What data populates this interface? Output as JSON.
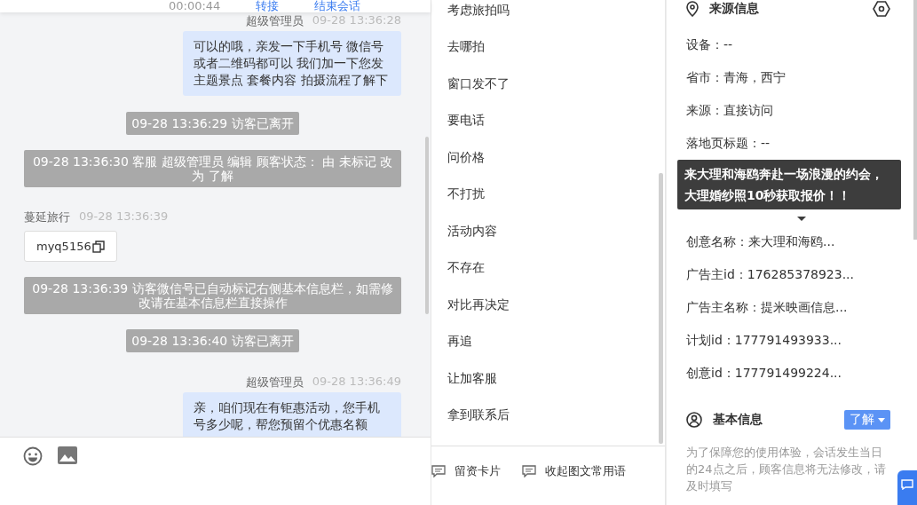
{
  "header": {
    "timer": "00:00:44",
    "actions": [
      "转接",
      "结束会话"
    ]
  },
  "messages": [
    {
      "kind": "meta",
      "outgoing": true,
      "name": "超级管理员",
      "time": "09-28 13:36:28"
    },
    {
      "kind": "bubble",
      "outgoing": true,
      "text": "可以的哦，亲发一下手机号 微信号或者二维码都可以 我们加一下您发主题景点 套餐内容 拍摄流程了解下"
    },
    {
      "kind": "system",
      "text": "09-28 13:36:29 访客已离开"
    },
    {
      "kind": "system",
      "text": "09-28 13:36:30 客服 超级管理员 编辑 顾客状态： 由 未标记 改为 了解"
    },
    {
      "kind": "meta",
      "outgoing": false,
      "name": "蔓延旅行",
      "time": "09-28 13:36:39"
    },
    {
      "kind": "card",
      "text": "myq5156"
    },
    {
      "kind": "system",
      "text": "09-28 13:36:39 访客微信号已自动标记右侧基本信息栏，如需修改请在基本信息栏直接操作"
    },
    {
      "kind": "system",
      "text": "09-28 13:36:40 访客已离开"
    },
    {
      "kind": "meta",
      "outgoing": true,
      "name": "超级管理员",
      "time": "09-28 13:36:49"
    },
    {
      "kind": "bubble",
      "outgoing": true,
      "text": "亲，咱们现在有钜惠活动，您手机号多少呢，帮您预留个优惠名额"
    }
  ],
  "quick_replies": [
    "考虑旅拍吗",
    "去哪拍",
    "窗口发不了",
    "要电话",
    "问价格",
    "不打扰",
    "活动内容",
    "不存在",
    "对比再决定",
    "再追",
    "让加客服",
    "拿到联系后"
  ],
  "quick_actions": [
    "留资卡片",
    "收起图文常用语"
  ],
  "source_info": {
    "title": "来源信息",
    "fields_top": [
      {
        "label": "设备：",
        "value": "--"
      },
      {
        "label": "省市：",
        "value": "青海，西宁"
      },
      {
        "label": "来源：",
        "value": "直接访问"
      },
      {
        "label": "落地页标题：",
        "value": "--"
      }
    ],
    "tooltip": "来大理和海鸥奔赴一场浪漫的约会，大理婚纱照10秒获取报价！！",
    "fields_bottom": [
      {
        "label": "创意名称：",
        "value": "来大理和海鸥..."
      },
      {
        "label": "广告主id：",
        "value": "176285378923..."
      },
      {
        "label": "广告主名称：",
        "value": "提米映画信息..."
      },
      {
        "label": "计划id：",
        "value": "177791493933..."
      },
      {
        "label": "创意id：",
        "value": "177791499224..."
      }
    ]
  },
  "basic_info": {
    "title": "基本信息",
    "status": "了解",
    "notice": "为了保障您的使用体验，会话发生当日的24点之后，顾客信息将无法修改，请及时填写"
  }
}
